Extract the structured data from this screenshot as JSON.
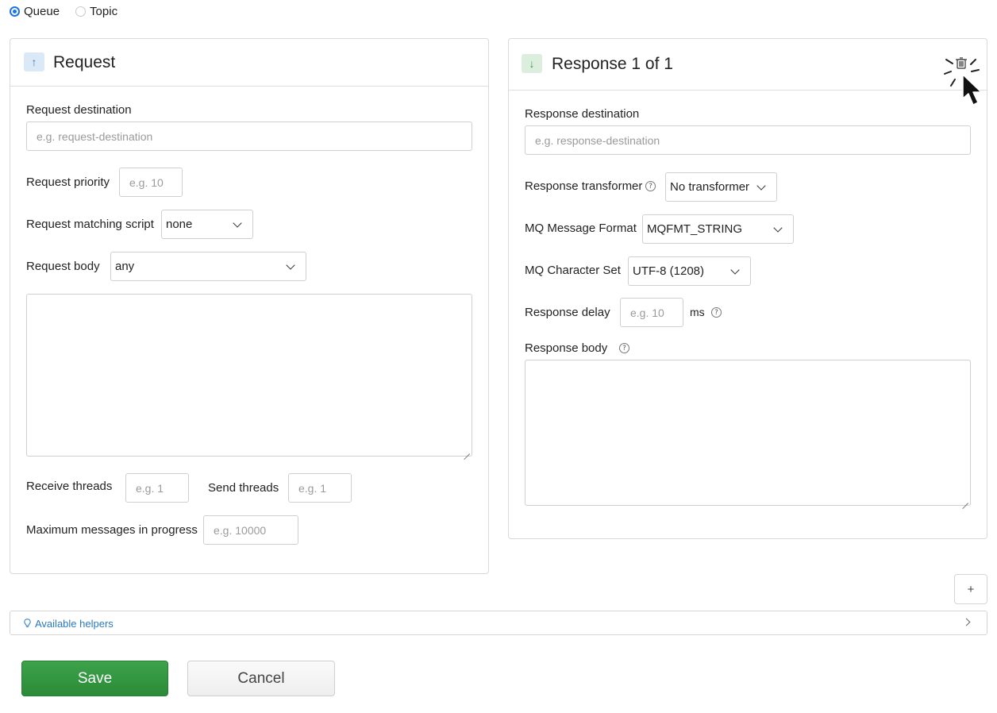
{
  "mode": {
    "options": [
      "Queue",
      "Topic"
    ],
    "selected": "Queue"
  },
  "request": {
    "title": "Request",
    "destination_label": "Request destination",
    "destination_placeholder": "e.g. request-destination",
    "priority_label": "Request priority",
    "priority_placeholder": "e.g. 10",
    "matching_script_label": "Request matching script",
    "matching_script_value": "none",
    "body_label": "Request body",
    "body_value": "any",
    "receive_threads_label": "Receive threads",
    "receive_threads_placeholder": "e.g. 1",
    "send_threads_label": "Send threads",
    "send_threads_placeholder": "e.g. 1",
    "max_messages_label": "Maximum messages in progress",
    "max_messages_placeholder": "e.g. 10000"
  },
  "response": {
    "title": "Response 1 of 1",
    "destination_label": "Response destination",
    "destination_placeholder": "e.g. response-destination",
    "transformer_label": "Response transformer",
    "transformer_value": "No transformer",
    "message_format_label": "MQ Message Format",
    "message_format_value": "MQFMT_STRING",
    "charset_label": "MQ Character Set",
    "charset_value": "UTF-8 (1208)",
    "delay_label": "Response delay",
    "delay_placeholder": "e.g. 10",
    "delay_unit": "ms",
    "body_label": "Response body"
  },
  "actions": {
    "add_label": "+",
    "helpers_label": "Available helpers",
    "save_label": "Save",
    "cancel_label": "Cancel"
  },
  "icons": {
    "up": "↑",
    "down": "↓",
    "help": "?"
  },
  "colors": {
    "accent_blue": "#1a73e8",
    "save_green": "#2e8f3b",
    "link_blue": "#2a78c2"
  }
}
